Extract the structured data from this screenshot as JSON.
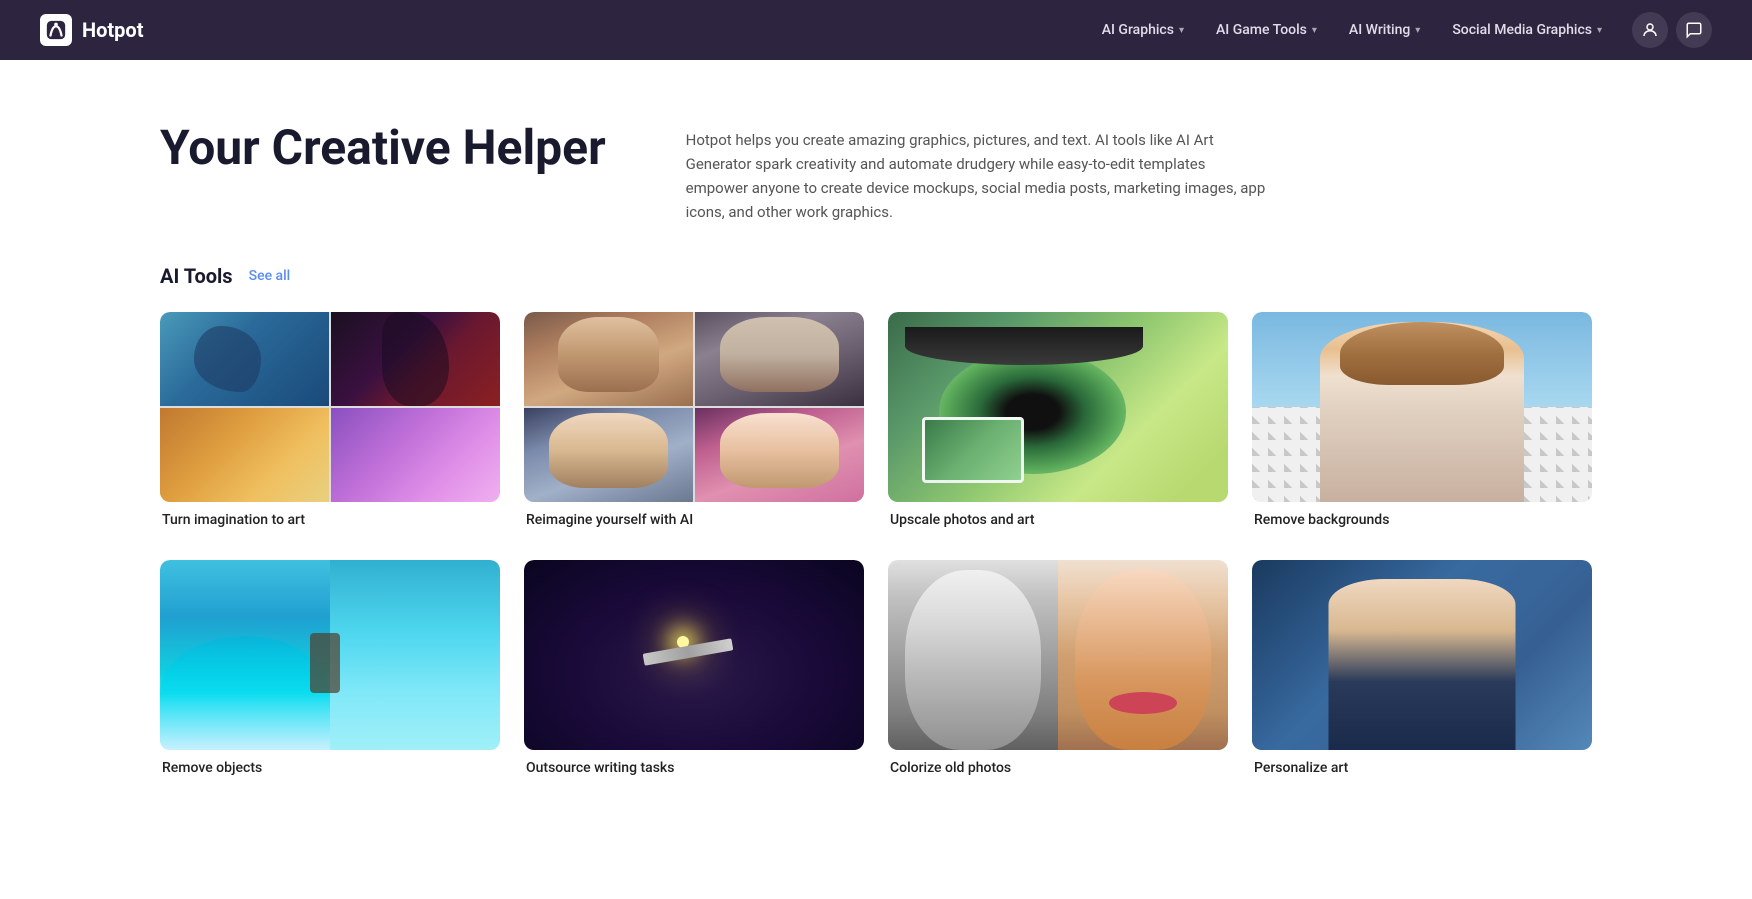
{
  "brand": {
    "name": "Hotpot",
    "logo_symbol": "☺"
  },
  "nav": {
    "items": [
      {
        "label": "AI Graphics",
        "has_dropdown": true
      },
      {
        "label": "AI Game Tools",
        "has_dropdown": true
      },
      {
        "label": "AI Writing",
        "has_dropdown": true
      },
      {
        "label": "Social Media Graphics",
        "has_dropdown": true
      }
    ]
  },
  "hero": {
    "title": "Your Creative Helper",
    "description": "Hotpot helps you create amazing graphics, pictures, and text. AI tools like AI Art Generator spark creativity and automate drudgery while easy-to-edit templates empower anyone to create device mockups, social media posts, marketing images, app icons, and other work graphics."
  },
  "ai_tools_section": {
    "heading": "AI Tools",
    "see_all_label": "See all",
    "tools": [
      {
        "label": "Turn imagination to art",
        "type": "art-mosaic"
      },
      {
        "label": "Reimagine yourself with AI",
        "type": "portrait-mosaic"
      },
      {
        "label": "Upscale photos and art",
        "type": "eye-closeup"
      },
      {
        "label": "Remove backgrounds",
        "type": "remove-bg"
      },
      {
        "label": "Remove objects",
        "type": "surfer"
      },
      {
        "label": "Outsource writing tasks",
        "type": "sparkler"
      },
      {
        "label": "Colorize old photos",
        "type": "colorize"
      },
      {
        "label": "Personalize art",
        "type": "mona-lisa"
      }
    ]
  }
}
